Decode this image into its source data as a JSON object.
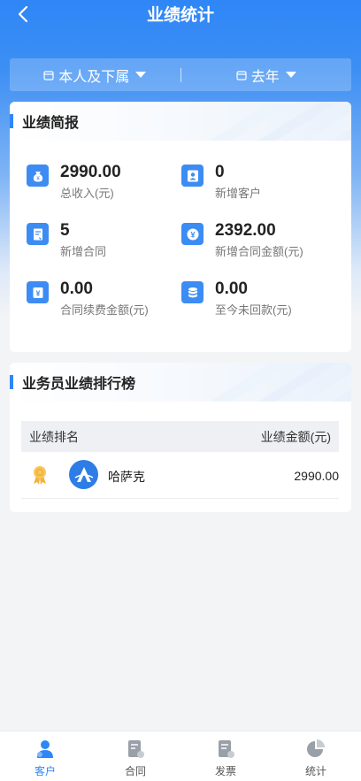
{
  "header": {
    "title": "业绩统计"
  },
  "filters": {
    "scope": "本人及下属",
    "period": "去年"
  },
  "summary": {
    "title": "业绩简报",
    "stats": [
      {
        "value": "2990.00",
        "label": "总收入(元)",
        "icon": "money-bag-icon"
      },
      {
        "value": "0",
        "label": "新增客户",
        "icon": "user-icon"
      },
      {
        "value": "5",
        "label": "新增合同",
        "icon": "contract-icon"
      },
      {
        "value": "2392.00",
        "label": "新增合同金额(元)",
        "icon": "yen-icon"
      },
      {
        "value": "0.00",
        "label": "合同续费金额(元)",
        "icon": "yen-doc-icon"
      },
      {
        "value": "0.00",
        "label": "至今未回款(元)",
        "icon": "coins-icon"
      }
    ]
  },
  "ranking": {
    "title": "业务员业绩排行榜",
    "columns": {
      "rank": "业绩排名",
      "amount": "业绩金额(元)"
    },
    "rows": [
      {
        "name": "哈萨克",
        "amount": "2990.00",
        "rank_icon": "medal-icon"
      }
    ]
  },
  "tabbar": [
    {
      "label": "客户",
      "icon": "customer-icon",
      "active": true
    },
    {
      "label": "合同",
      "icon": "contract-icon",
      "active": false
    },
    {
      "label": "发票",
      "icon": "invoice-icon",
      "active": false
    },
    {
      "label": "统计",
      "icon": "statistics-icon",
      "active": false
    }
  ],
  "colors": {
    "primary": "#2f86f6",
    "icon_bg": "#3c8cf3",
    "medal": "#f2b33d"
  }
}
